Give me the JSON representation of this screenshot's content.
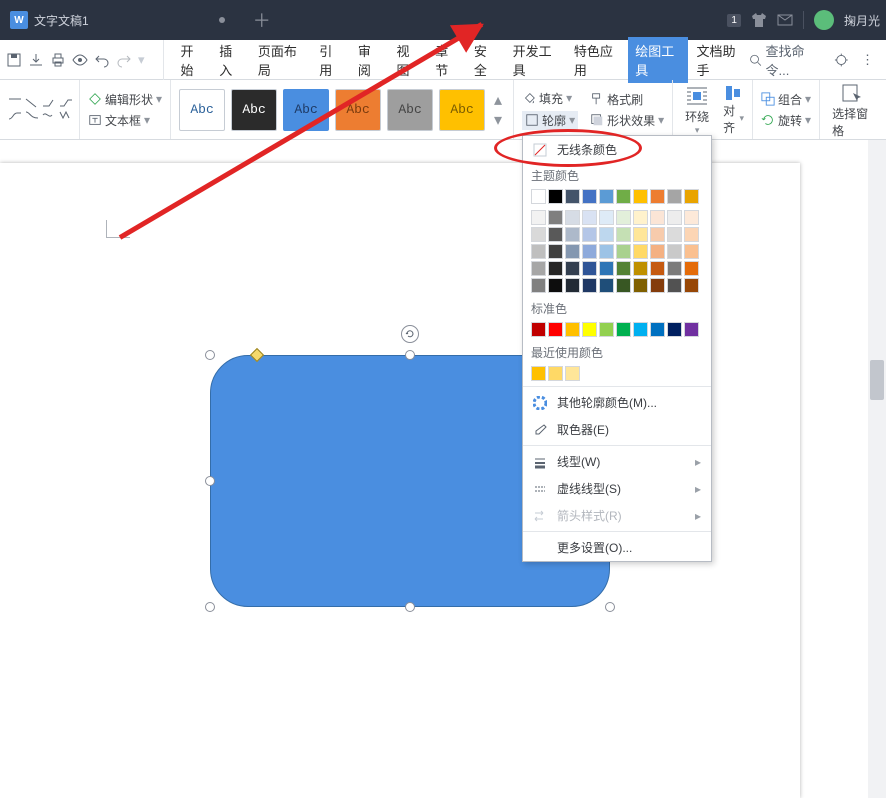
{
  "titlebar": {
    "doc_letter": "W",
    "doc_name": "文字文稿1",
    "badge": "1",
    "user_name": "掬月光"
  },
  "menubar": {
    "items": [
      "开始",
      "插入",
      "页面布局",
      "引用",
      "审阅",
      "视图",
      "章节",
      "安全",
      "开发工具",
      "特色应用",
      "绘图工具",
      "文档助手"
    ],
    "active_index": 10,
    "search_placeholder": "查找命令..."
  },
  "ribbon": {
    "edit_shape": "编辑形状",
    "text_box": "文本框",
    "style_label": "Abc",
    "fill": "填充",
    "outline": "轮廓",
    "format_painter": "格式刷",
    "shape_effects": "形状效果",
    "wrap": "环绕",
    "align": "对齐",
    "group": "组合",
    "rotate": "旋转",
    "select_pane": "选择窗格"
  },
  "popover": {
    "no_line": "无线条颜色",
    "theme_colors": "主题颜色",
    "std_colors": "标准色",
    "recent_colors": "最近使用颜色",
    "more_colors": "其他轮廓颜色(M)...",
    "eyedropper": "取色器(E)",
    "line_type": "线型(W)",
    "dash_type": "虚线线型(S)",
    "arrow_style": "箭头样式(R)",
    "more_settings": "更多设置(O)..."
  },
  "colors": {
    "theme_row1": [
      "#ffffff",
      "#000000",
      "#44546a",
      "#4472c4",
      "#5b9bd5",
      "#70ad47",
      "#ffc000",
      "#ed7d31",
      "#a5a5a5",
      "#e9a400"
    ],
    "theme_shades": [
      [
        "#f2f2f2",
        "#7f7f7f",
        "#d6dce5",
        "#d9e2f3",
        "#deebf7",
        "#e2efda",
        "#fff2cc",
        "#fbe5d6",
        "#ededed",
        "#fde9d9"
      ],
      [
        "#d9d9d9",
        "#595959",
        "#adb9ca",
        "#b4c6e7",
        "#bdd7ee",
        "#c5e0b4",
        "#ffe699",
        "#f7cbac",
        "#dbdbdb",
        "#fcd5b4"
      ],
      [
        "#bfbfbf",
        "#404040",
        "#8497b0",
        "#8eaadb",
        "#9cc3e6",
        "#a9d18e",
        "#ffd966",
        "#f4b183",
        "#c9c9c9",
        "#fac090"
      ],
      [
        "#a6a6a6",
        "#262626",
        "#333f50",
        "#2f5597",
        "#2e75b6",
        "#548235",
        "#bf9000",
        "#c55a11",
        "#7b7b7b",
        "#e46c0a"
      ],
      [
        "#808080",
        "#0d0d0d",
        "#222a35",
        "#1f3864",
        "#1f4e79",
        "#385723",
        "#806000",
        "#843c0c",
        "#525252",
        "#974706"
      ]
    ],
    "standard": [
      "#c00000",
      "#ff0000",
      "#ffc000",
      "#ffff00",
      "#92d050",
      "#00b050",
      "#00b0f0",
      "#0070c0",
      "#002060",
      "#7030a0"
    ],
    "recent": [
      "#ffc000",
      "#ffd966",
      "#ffe699"
    ]
  }
}
